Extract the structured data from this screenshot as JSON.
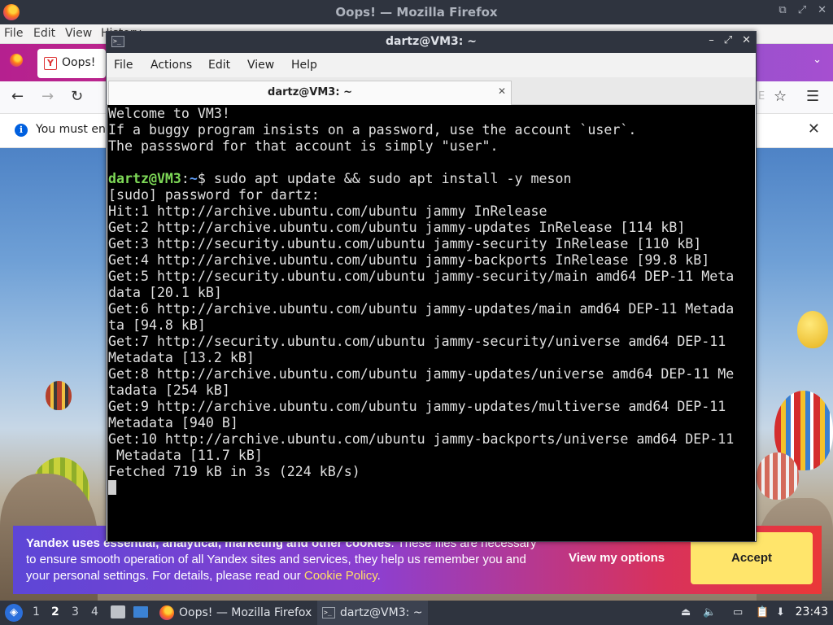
{
  "firefox": {
    "window_title": "Oops! — Mozilla Firefox",
    "menu": [
      "File",
      "Edit",
      "View",
      "History"
    ],
    "tab_title": "Oops!",
    "notice_text": "You must enable JavaScript",
    "url_tail": "E"
  },
  "cookie_banner": {
    "lead": "Yandex uses essential, analytical, marketing and other cookies",
    "body": ". These files are necessary to ensure smooth operation of all Yandex sites and services, they help us remember you and your personal settings. For details, please read our ",
    "policy_link": "Cookie Policy",
    "tail": ".",
    "options_label": "View my options",
    "accept_label": "Accept"
  },
  "terminal": {
    "window_title": "dartz@VM3: ~",
    "menu": [
      "File",
      "Actions",
      "Edit",
      "View",
      "Help"
    ],
    "tab_title": "dartz@VM3: ~",
    "prompt_user": "dartz@VM3",
    "prompt_sep": ":",
    "prompt_path": "~",
    "prompt_symbol": "$",
    "command": " sudo apt update && sudo apt install -y meson",
    "motd": "Welcome to VM3!\nIf a buggy program insists on a password, use the account `user`.\nThe passsword for that account is simply \"user\".\n",
    "output": "[sudo] password for dartz:\nHit:1 http://archive.ubuntu.com/ubuntu jammy InRelease\nGet:2 http://archive.ubuntu.com/ubuntu jammy-updates InRelease [114 kB]\nGet:3 http://security.ubuntu.com/ubuntu jammy-security InRelease [110 kB]\nGet:4 http://archive.ubuntu.com/ubuntu jammy-backports InRelease [99.8 kB]\nGet:5 http://security.ubuntu.com/ubuntu jammy-security/main amd64 DEP-11 Meta\ndata [20.1 kB]\nGet:6 http://archive.ubuntu.com/ubuntu jammy-updates/main amd64 DEP-11 Metada\nta [94.8 kB]\nGet:7 http://security.ubuntu.com/ubuntu jammy-security/universe amd64 DEP-11\nMetadata [13.2 kB]\nGet:8 http://archive.ubuntu.com/ubuntu jammy-updates/universe amd64 DEP-11 Me\ntadata [254 kB]\nGet:9 http://archive.ubuntu.com/ubuntu jammy-updates/multiverse amd64 DEP-11\nMetadata [940 B]\nGet:10 http://archive.ubuntu.com/ubuntu jammy-backports/universe amd64 DEP-11\n Metadata [11.7 kB]\nFetched 719 kB in 3s (224 kB/s)\n"
  },
  "taskbar": {
    "workspaces": [
      "1",
      "2",
      "3",
      "4"
    ],
    "active_workspace": "2",
    "tasks": [
      {
        "label": "Oops! — Mozilla Firefox",
        "icon": "firefox-icon"
      },
      {
        "label": "dartz@VM3: ~",
        "icon": "terminal-icon"
      }
    ],
    "clock": "23:43"
  },
  "colors": {
    "prompt_user": "#7ed957",
    "prompt_path": "#5f9cf5",
    "cookie_accept": "#ffe56b",
    "cookie_policy_link": "#ffe066"
  }
}
